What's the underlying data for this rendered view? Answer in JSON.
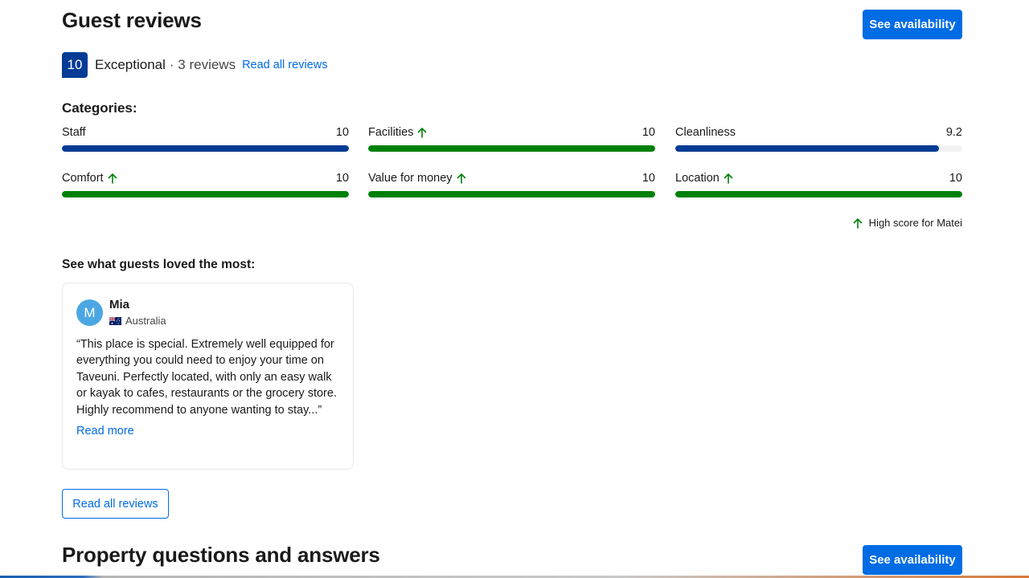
{
  "header": {
    "title": "Guest reviews",
    "cta_label": "See availability"
  },
  "rating": {
    "score": "10",
    "word": "Exceptional",
    "count_text": "· 3 reviews",
    "read_all_link": "Read all reviews"
  },
  "categories": {
    "label": "Categories:",
    "items": [
      {
        "name": "Staff",
        "score": "10",
        "fill": 1.0,
        "high": false,
        "color": "#003b95"
      },
      {
        "name": "Facilities",
        "score": "10",
        "fill": 1.0,
        "high": true,
        "color": "#008009"
      },
      {
        "name": "Cleanliness",
        "score": "9.2",
        "fill": 0.92,
        "high": false,
        "color": "#003b95"
      },
      {
        "name": "Comfort",
        "score": "10",
        "fill": 1.0,
        "high": true,
        "color": "#008009"
      },
      {
        "name": "Value for money",
        "score": "10",
        "fill": 1.0,
        "high": true,
        "color": "#008009"
      },
      {
        "name": "Location",
        "score": "10",
        "fill": 1.0,
        "high": true,
        "color": "#008009"
      }
    ],
    "high_score_note": "High score for Matei"
  },
  "loved": {
    "label": "See what guests loved the most:",
    "review": {
      "avatar_letter": "M",
      "name": "Mia",
      "country": "Australia",
      "flag_icon": "australia-flag-icon",
      "text": "“This place is special. Extremely well equipped for everything you could need to enjoy your time on Taveuni. Perfectly located, with only an easy walk or kayak to cafes, restaurants or the grocery store. Highly recommend to anyone wanting to stay...”",
      "read_more": "Read more"
    }
  },
  "read_all_button": "Read all reviews",
  "qa": {
    "title": "Property questions and answers",
    "cta_label": "See availability"
  },
  "colors": {
    "primary": "#006ce4",
    "score_blue": "#003b95",
    "green": "#008009"
  }
}
